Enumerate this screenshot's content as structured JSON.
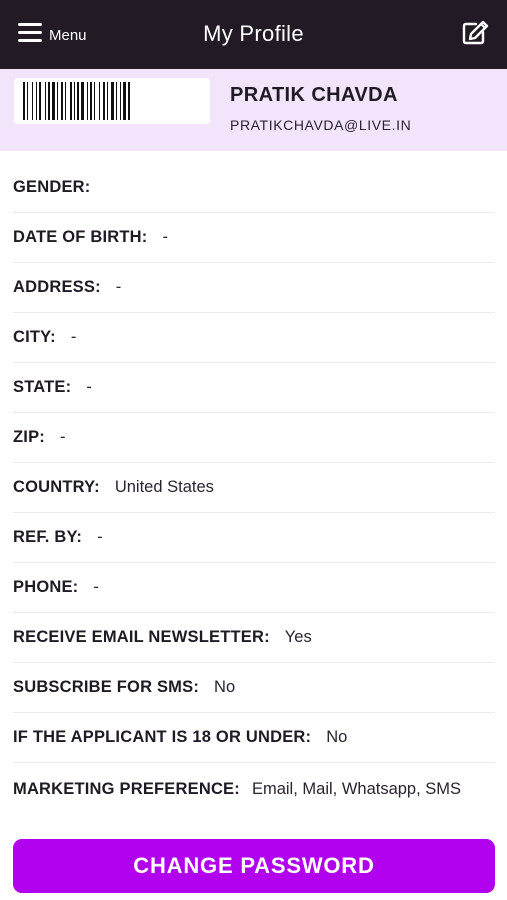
{
  "header": {
    "menu_label": "Menu",
    "title": "My Profile",
    "menu_icon": "hamburger-icon",
    "edit_icon": "edit-icon"
  },
  "profile": {
    "name": "PRATIK CHAVDA",
    "email": "PRATIKCHAVDA@LIVE.IN"
  },
  "fields": [
    {
      "label": "GENDER:",
      "value": ""
    },
    {
      "label": "DATE OF BIRTH:",
      "value": "-"
    },
    {
      "label": "ADDRESS:",
      "value": "-"
    },
    {
      "label": "CITY:",
      "value": "-"
    },
    {
      "label": "STATE:",
      "value": "-"
    },
    {
      "label": "ZIP:",
      "value": "-"
    },
    {
      "label": "COUNTRY:",
      "value": "United States"
    },
    {
      "label": "REF. BY:",
      "value": "-"
    },
    {
      "label": "PHONE:",
      "value": "-"
    },
    {
      "label": "RECEIVE EMAIL NEWSLETTER:",
      "value": "Yes"
    },
    {
      "label": "SUBSCRIBE FOR SMS:",
      "value": "No"
    },
    {
      "label": "IF THE APPLICANT IS 18 OR UNDER:",
      "value": "No"
    },
    {
      "label": "MARKETING PREFERENCE:",
      "value": "Email, Mail, Whatsapp, SMS"
    }
  ],
  "actions": {
    "change_password_label": "CHANGE PASSWORD"
  },
  "colors": {
    "header_bg": "#221a25",
    "profile_bg": "#f2e4fb",
    "accent": "#b000ee"
  }
}
